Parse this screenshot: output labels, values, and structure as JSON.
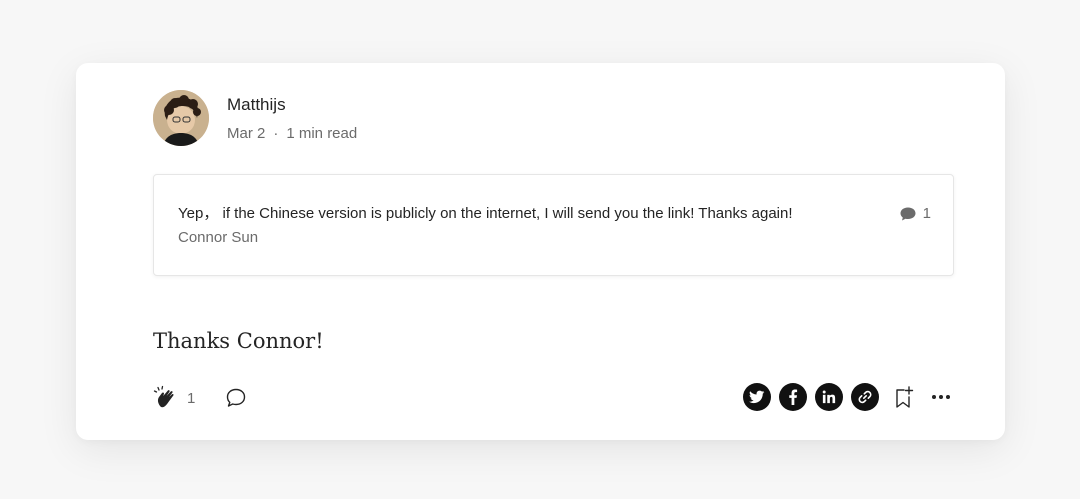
{
  "author": {
    "name": "Matthijs",
    "date": "Mar 2",
    "separator": "·",
    "read_time": "1 min read"
  },
  "quoted_response": {
    "text": "Yep， if the Chinese version is publicly on the internet, I will send you the link! Thanks again!",
    "author": "Connor Sun",
    "response_count": "1",
    "icon": "speech-bubble-icon"
  },
  "response": {
    "text": "Thanks Connor!"
  },
  "actions": {
    "clap_count": "1",
    "clap_icon": "clap-icon",
    "comment_icon": "comment-icon",
    "share_icons": [
      "twitter-icon",
      "facebook-icon",
      "linkedin-icon",
      "link-icon"
    ],
    "bookmark_icon": "bookmark-add-icon",
    "more_icon": "more-icon"
  },
  "colors": {
    "text": "#242424",
    "muted": "#6b6b6b",
    "icon_dark": "#111111",
    "border": "#e6e6e6"
  }
}
